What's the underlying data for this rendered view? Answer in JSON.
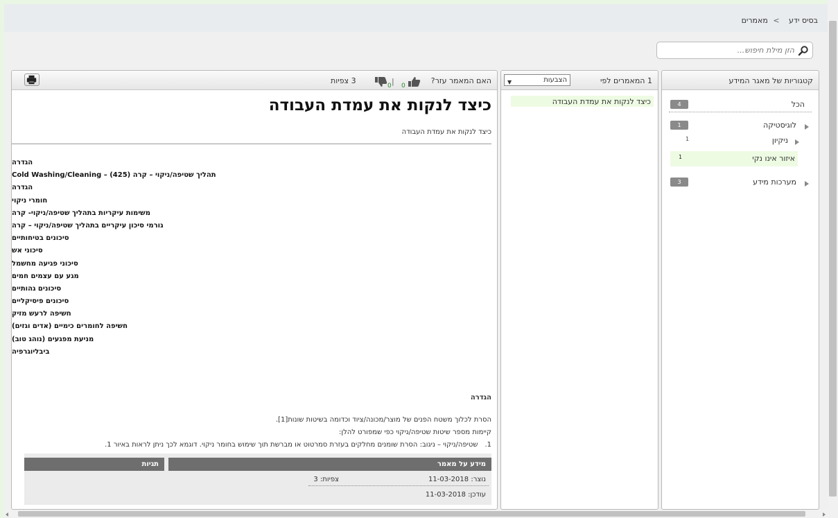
{
  "breadcrumb": {
    "root": "בסיס ידע",
    "separator": ">",
    "current": "מאמרים"
  },
  "search": {
    "placeholder": "הזן מילת חיפוש..."
  },
  "categories": {
    "title": "קטגוריות של מאגר המידע",
    "all": {
      "label": "הכל",
      "count": "4"
    },
    "logistics": {
      "label": "לוגיסטיקה",
      "count": "1"
    },
    "cleaning": {
      "label": "ניקיון",
      "count": "1"
    },
    "dirty_area": {
      "label": "איזור אינו נקי",
      "count": "1"
    },
    "info_systems": {
      "label": "מערכות מידע",
      "count": "3"
    }
  },
  "article_list": {
    "title": "1 המאמרים לפי",
    "sort_value": "הצבעות",
    "items": [
      "כיצד לנקות את עמדת העבודה"
    ]
  },
  "article": {
    "helpful_question": "האם המאמר עזר?",
    "likes": "0",
    "dislikes": "0",
    "views_label": "3 צפיות",
    "title": "כיצד לנקות את עמדת העבודה",
    "subtitle": "כיצד לנקות את עמדת העבודה",
    "toc": [
      "הגדרה",
      "תהליך שטיפה/ניקוי – קרה (425) – Cold Washing/Cleaning",
      "הגדרה",
      "חומרי ניקוי",
      "משימות עיקריות בתהליך שטיפה/ניקוי- קרה",
      "גורמי סיכון עיקריים בתהליך שטיפה/ניקוי – קרה",
      "סיכונים בטיחותיים",
      "סיכוני אש",
      "סיכוני פגיעה מחשמל",
      "מגע עם עצמים חמים",
      "סיכונים גהותיים",
      "סיכונים פיסיקליים",
      "חשיפה לרעש מזיק",
      "חשיפה לחומרים כימיים (אדים וגזים)",
      "מניעת מפגעים (נוהג טוב)",
      "ביבליוגרפיה"
    ],
    "section_head": "הגדרה",
    "para1": "הסרת לכלוך משטח הפנים של מוצר/מכונה/ציוד וכדומה בשיטות שונות[1].",
    "para2": "קיימות מספר שיטות שטיפה/ניקוי כפי שמפורט להלן:",
    "para3_num": "1.",
    "para3": "שטיפה/ניקוי – ניגוב: הסרת שומנים מחלקים בעזרת סמרטוט או מברשת תוך שימוש בחומר ניקוי.  דוגמא לכך ניתן לראות באיור 1."
  },
  "info_box": {
    "meta_title": "מידע על מאמר",
    "tags_title": "תגיות",
    "created": "נוצר: 11-03-2018",
    "updated": "עודכן: 11-03-2018",
    "views": "צפיות: 3"
  },
  "colors": {
    "selected_bg": "#eefbe3",
    "badge": "#8a8a8a",
    "count_green": "#2a8a2a"
  }
}
